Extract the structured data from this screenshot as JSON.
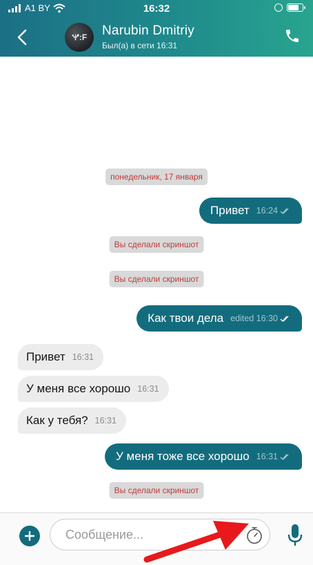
{
  "status_bar": {
    "carrier": "A1 BY",
    "time": "16:32"
  },
  "header": {
    "contact_name": "Narubin Dmitriy",
    "last_seen": "Был(а) в сети 16:31",
    "avatar_text": "🝤:F"
  },
  "chat": {
    "date_separator": "понедельник, 17 января",
    "messages": [
      {
        "direction": "out",
        "text": "Привет",
        "meta": "16:24"
      },
      {
        "direction": "system",
        "text": "Вы сделали скриншот"
      },
      {
        "direction": "system",
        "text": "Вы сделали скриншот"
      },
      {
        "direction": "out",
        "text": "Как твои дела",
        "meta": "edited 16:30"
      },
      {
        "direction": "in",
        "text": "Привет",
        "meta": "16:31"
      },
      {
        "direction": "in",
        "text": "У меня все хорошо",
        "meta": "16:31"
      },
      {
        "direction": "in",
        "text": "Как у тебя?",
        "meta": "16:31"
      },
      {
        "direction": "out",
        "text": "У меня тоже все хорошо",
        "meta": "16:31"
      },
      {
        "direction": "system",
        "text": "Вы сделали скриншот"
      }
    ]
  },
  "composer": {
    "placeholder": "Сообщение..."
  },
  "colors": {
    "header_start": "#1c6f86",
    "header_end": "#28a48f",
    "outgoing_bubble": "#136c7d",
    "incoming_bubble": "#ececec",
    "notice_text": "#c13a3a",
    "annotation_arrow": "#e8191c"
  },
  "icons": [
    "signal-icon",
    "wifi-icon",
    "lock-rotation-icon",
    "battery-icon",
    "back-icon",
    "phone-icon",
    "add-icon",
    "timer-icon",
    "microphone-icon",
    "read-check-icon"
  ]
}
